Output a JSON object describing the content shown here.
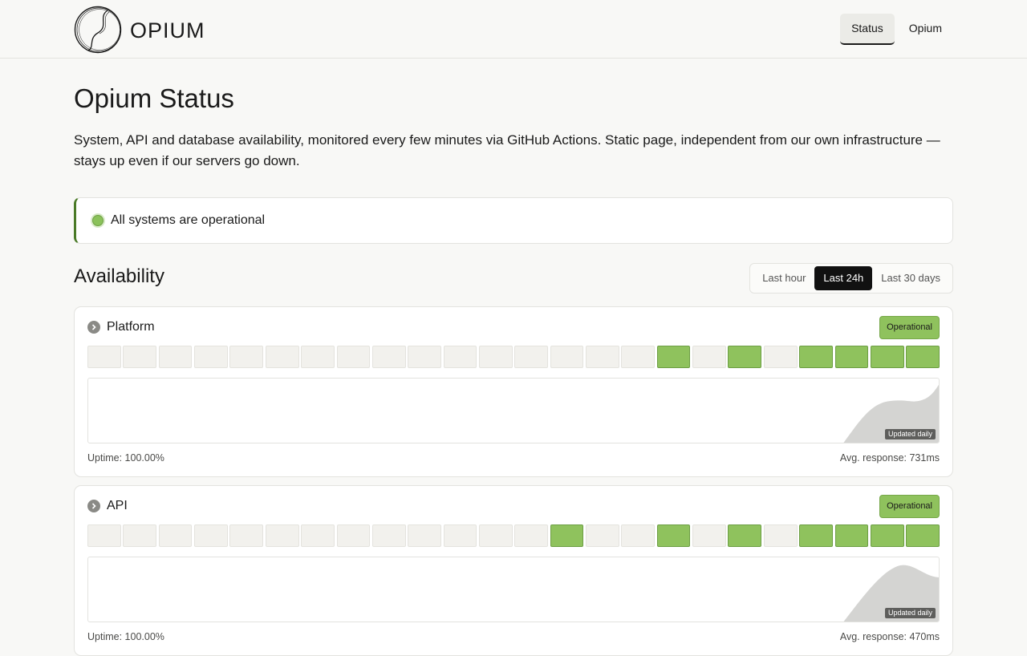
{
  "header": {
    "brand": "OPIUM",
    "nav": [
      {
        "label": "Status",
        "active": true
      },
      {
        "label": "Opium",
        "active": false
      }
    ]
  },
  "page": {
    "title": "Opium Status",
    "description": "System, API and database availability, monitored every few minutes via GitHub Actions. Static page, independent from our own infrastructure — stays up even if our servers go down."
  },
  "overall_status": {
    "text": "All systems are operational",
    "color": "#8bc25b"
  },
  "availability": {
    "title": "Availability",
    "ranges": [
      {
        "label": "Last hour",
        "active": false
      },
      {
        "label": "Last 24h",
        "active": true
      },
      {
        "label": "Last 30 days",
        "active": false
      }
    ]
  },
  "services": [
    {
      "name": "Platform",
      "status": "Operational",
      "bars": [
        0,
        0,
        0,
        0,
        0,
        0,
        0,
        0,
        0,
        0,
        0,
        0,
        0,
        0,
        0,
        0,
        1,
        0,
        1,
        0,
        1,
        1,
        1,
        1
      ],
      "spark_note": "Updated daily",
      "uptime": "Uptime: 100.00%",
      "avg_response": "Avg. response: 731ms"
    },
    {
      "name": "API",
      "status": "Operational",
      "bars": [
        0,
        0,
        0,
        0,
        0,
        0,
        0,
        0,
        0,
        0,
        0,
        0,
        0,
        1,
        0,
        0,
        1,
        0,
        1,
        0,
        1,
        1,
        1,
        1
      ],
      "spark_note": "Updated daily",
      "uptime": "Uptime: 100.00%",
      "avg_response": "Avg. response: 470ms"
    }
  ],
  "colors": {
    "up": "#8fc25d",
    "empty": "#f2f1ed",
    "accent_border": "#4a7a27",
    "spark_fill": "#d4d4d2"
  }
}
